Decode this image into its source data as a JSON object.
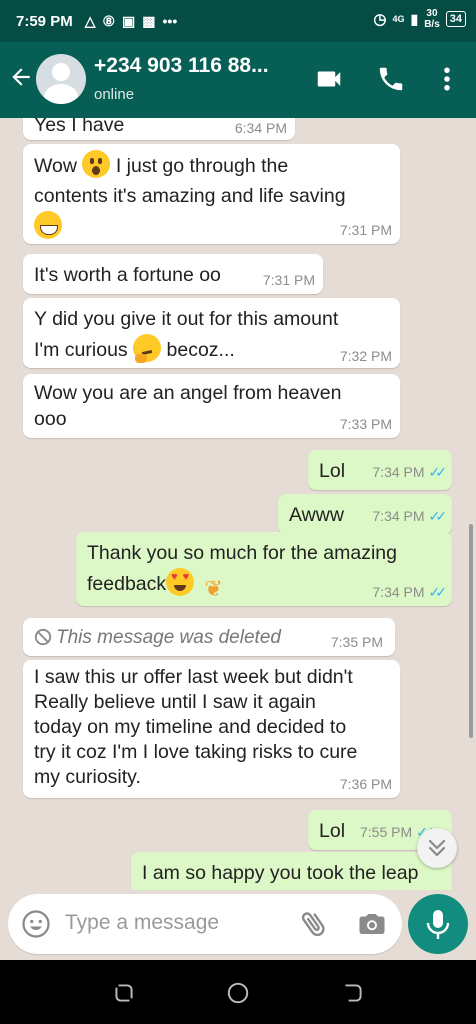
{
  "status_bar": {
    "time": "7:59 PM",
    "network": "4G",
    "speed_value": "30",
    "speed_unit": "B/s",
    "battery": "34"
  },
  "header": {
    "contact_name": "+234 903 116 88...",
    "contact_status": "online"
  },
  "messages": [
    {
      "dir": "in",
      "text": "Yes I have",
      "time": "6:34 PM"
    },
    {
      "dir": "in",
      "text_a": "Wow",
      "text_b": "I just go through the",
      "text_c": "contents it's amazing and life saving",
      "time": "7:31 PM"
    },
    {
      "dir": "in",
      "text": "It's worth a fortune oo",
      "time": "7:31 PM"
    },
    {
      "dir": "in",
      "text_a": "Y did you give it out for this amount",
      "text_b": "I'm curious",
      "text_c": "becoz...",
      "time": "7:32 PM"
    },
    {
      "dir": "in",
      "text_a": "Wow you are an angel from heaven",
      "text_b": "ooo",
      "time": "7:33 PM"
    },
    {
      "dir": "out",
      "text": "Lol",
      "time": "7:34 PM"
    },
    {
      "dir": "out",
      "text": "Awww",
      "time": "7:34 PM"
    },
    {
      "dir": "out",
      "text_a": "Thank you so much for the amazing",
      "text_b": "feedback",
      "time": "7:34 PM"
    },
    {
      "dir": "in",
      "text": "This message was deleted",
      "time": "7:35 PM"
    },
    {
      "dir": "in",
      "lines": [
        "I saw this ur offer last week but didn't",
        "Really believe until I saw it again",
        "today on my timeline and decided to",
        "try it coz I'm I love taking risks to cure",
        "my curiosity."
      ],
      "time": "7:36 PM"
    },
    {
      "dir": "out",
      "text": "Lol",
      "time": "7:55 PM"
    },
    {
      "dir": "out",
      "text": "I am so happy you took the leap"
    }
  ],
  "composer": {
    "placeholder": "Type a message"
  },
  "colors": {
    "header": "#075e54",
    "status_bar": "#054d44",
    "outgoing": "#dcf8c6",
    "incoming": "#ffffff",
    "ticks": "#34b7f1",
    "mic": "#128c7e"
  }
}
